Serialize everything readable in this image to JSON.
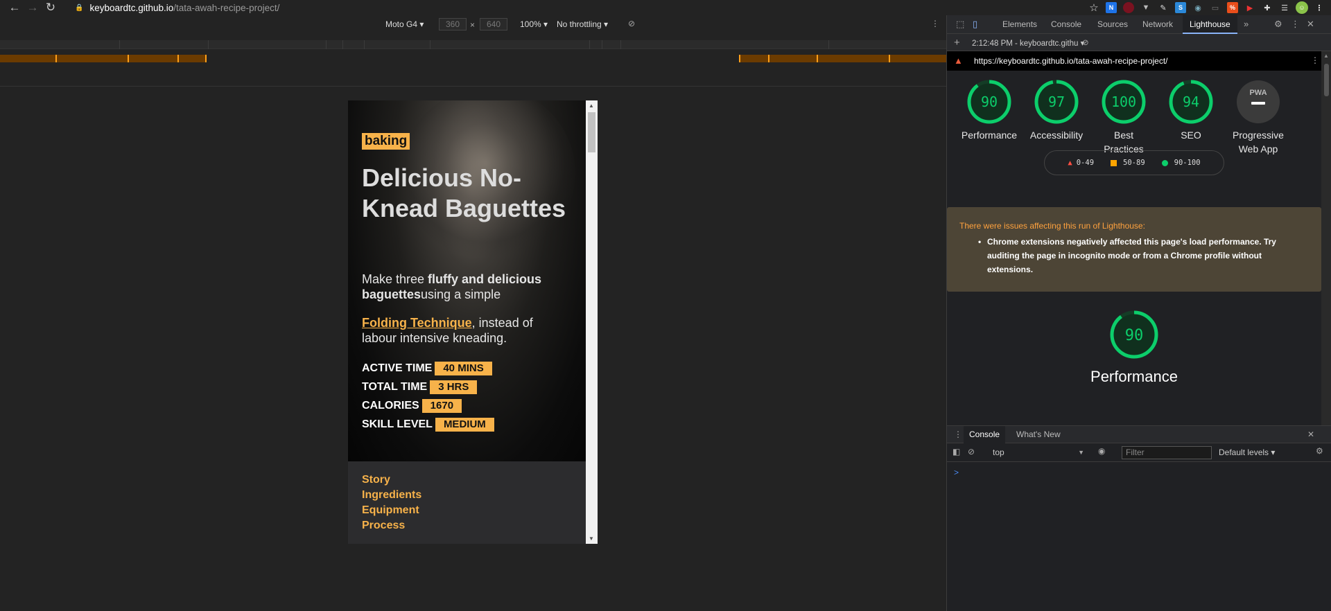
{
  "browser": {
    "url_host": "keyboardtc.github.io",
    "url_path": "/tata-awah-recipe-project/"
  },
  "device_toolbar": {
    "device": "Moto G4",
    "width": "360",
    "height": "640",
    "times": "×",
    "zoom": "100%",
    "throttling": "No throttling"
  },
  "recipe": {
    "tag": "baking",
    "title": "Delicious No-Knead Baguettes",
    "desc_prefix": "Make three ",
    "desc_bold": "fluffy and delicious baguettes",
    "desc_suffix": "using a simple",
    "technique_link": "Folding Technique",
    "technique_suffix": ", instead of labour intensive kneading.",
    "stats": [
      {
        "label": "ACTIVE TIME",
        "value": "40 MINS"
      },
      {
        "label": "TOTAL TIME",
        "value": "3 HRS"
      },
      {
        "label": "CALORIES",
        "value": "1670"
      },
      {
        "label": "SKILL LEVEL",
        "value": "MEDIUM"
      }
    ],
    "nav": [
      "Story",
      "Ingredients",
      "Equipment",
      "Process"
    ]
  },
  "devtools": {
    "tabs": [
      "Elements",
      "Console",
      "Sources",
      "Network",
      "Lighthouse"
    ],
    "active_tab": "Lighthouse",
    "report_time": "2:12:48 PM - keyboardtc.githu",
    "report_url": "https://keyboardtc.github.io/tata-awah-recipe-project/",
    "scores": [
      {
        "label": "Performance",
        "value": "90",
        "score": 90
      },
      {
        "label": "Accessibility",
        "value": "97",
        "score": 97
      },
      {
        "label": "Best Practices",
        "value": "100",
        "score": 100
      },
      {
        "label": "SEO",
        "value": "94",
        "score": 94
      },
      {
        "label": "Progressive Web App",
        "value": "PWA",
        "score": null
      }
    ],
    "legend": [
      {
        "range": "0-49",
        "color": "#ff4e42"
      },
      {
        "range": "50-89",
        "color": "#ffa400"
      },
      {
        "range": "90-100",
        "color": "#0cce6b"
      }
    ],
    "warning_title": "There were issues affecting this run of Lighthouse:",
    "warning_text": "Chrome extensions negatively affected this page's load performance. Try auditing the page in incognito mode or from a Chrome profile without extensions.",
    "perf_score": "90",
    "perf_label": "Performance",
    "console_tabs": [
      "Console",
      "What's New"
    ],
    "console_context": "top",
    "filter_placeholder": "Filter",
    "levels": "Default levels",
    "prompt": ">"
  },
  "colors": {
    "accent": "#f7b24a",
    "good": "#0cce6b"
  }
}
